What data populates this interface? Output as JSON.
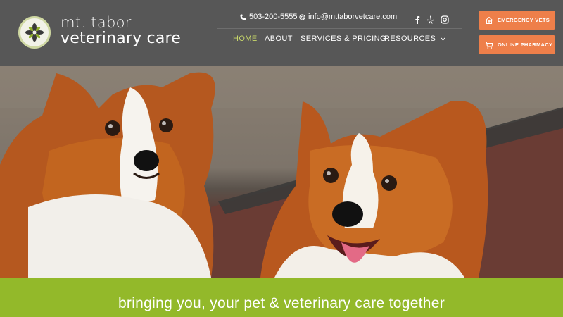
{
  "brand": {
    "line1": "mt. tabor",
    "line2": "veterinary care",
    "logo_icon": "flower-icon"
  },
  "contact": {
    "phone": "503-200-5555",
    "email": "info@mttaborvetcare.com"
  },
  "social": [
    "facebook-icon",
    "yelp-icon",
    "instagram-icon"
  ],
  "nav": {
    "items": [
      {
        "label": "HOME",
        "active": true
      },
      {
        "label": "ABOUT",
        "active": false
      },
      {
        "label": "SERVICES & PRICING",
        "active": false
      },
      {
        "label": "RESOURCES",
        "active": false,
        "has_dropdown": true
      }
    ]
  },
  "buttons": {
    "emergency": "EMERGENCY VETS",
    "pharmacy": "ONLINE PHARMACY"
  },
  "hero": {
    "image": "two-sheltie-dogs-photo"
  },
  "tagline": "bringing you, your pet & veterinary care together",
  "colors": {
    "header": "#575757",
    "accent_orange": "#ee7f4a",
    "active_nav": "#c8d86a",
    "tagline_green": "#93b92a"
  }
}
